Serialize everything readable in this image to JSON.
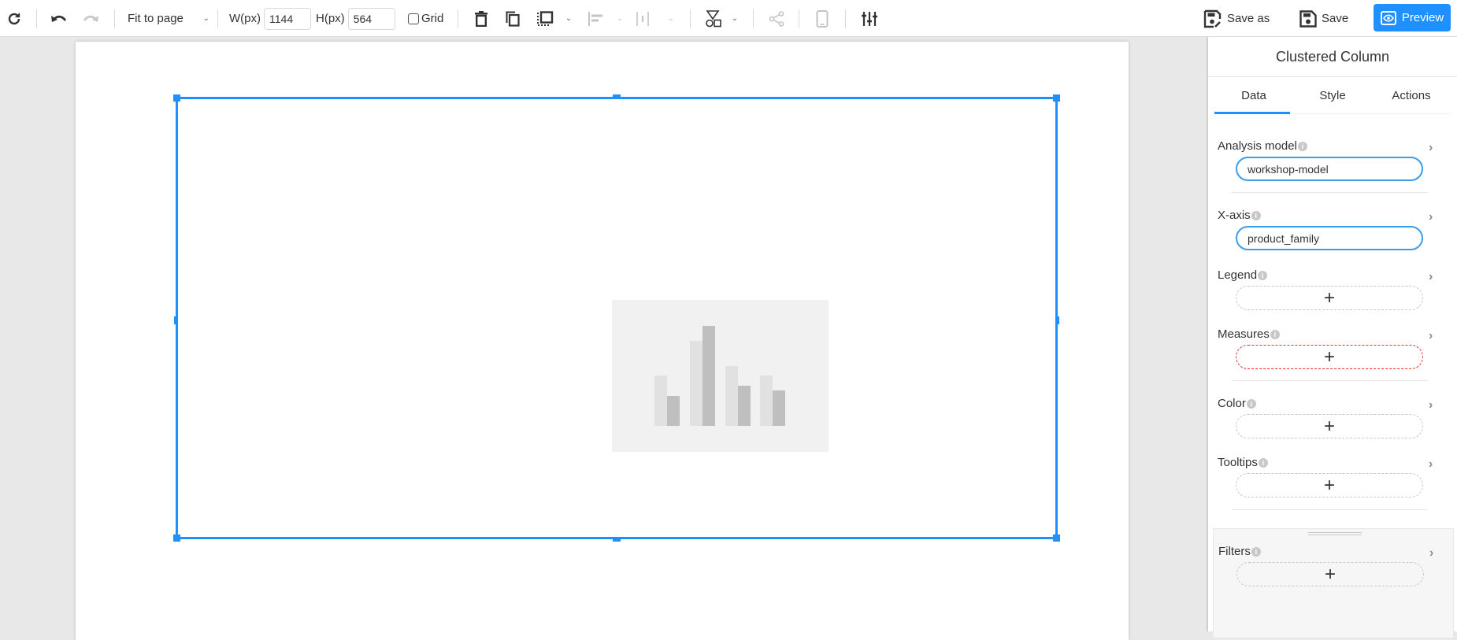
{
  "toolbar": {
    "refresh_icon": "refresh-icon",
    "undo_icon": "undo-icon",
    "redo_icon": "redo-icon",
    "zoom_mode": "Fit to page",
    "width_label": "W(px)",
    "width_value": "1144",
    "height_label": "H(px)",
    "height_value": "564",
    "grid_label": "Grid",
    "grid_checked": false,
    "save_as_label": "Save as",
    "save_label": "Save",
    "preview_label": "Preview"
  },
  "canvas": {
    "widget": "clustered-column-placeholder",
    "selected": true,
    "placeholder_colors": {
      "light": "#e1e1e1",
      "dark": "#bfbfbf",
      "bg": "#f1f1f1"
    }
  },
  "sidebar": {
    "title": "Clustered Column",
    "tabs": [
      {
        "label": "Data",
        "active": true
      },
      {
        "label": "Style",
        "active": false
      },
      {
        "label": "Actions",
        "active": false
      }
    ],
    "sections": [
      {
        "label": "Analysis model",
        "value": "workshop-model",
        "state": "filled"
      },
      {
        "label": "X-axis",
        "value": "product_family",
        "state": "filled"
      },
      {
        "label": "Legend",
        "value": "+",
        "state": "empty"
      },
      {
        "label": "Measures",
        "value": "+",
        "state": "required"
      },
      {
        "label": "Color",
        "value": "+",
        "state": "empty"
      },
      {
        "label": "Tooltips",
        "value": "+",
        "state": "empty"
      },
      {
        "label": "Filters",
        "value": "+",
        "state": "empty"
      }
    ]
  },
  "colors": {
    "accent": "#1e90ff",
    "required": "#e62e2e",
    "canvas_bg": "#e8e8e8"
  }
}
